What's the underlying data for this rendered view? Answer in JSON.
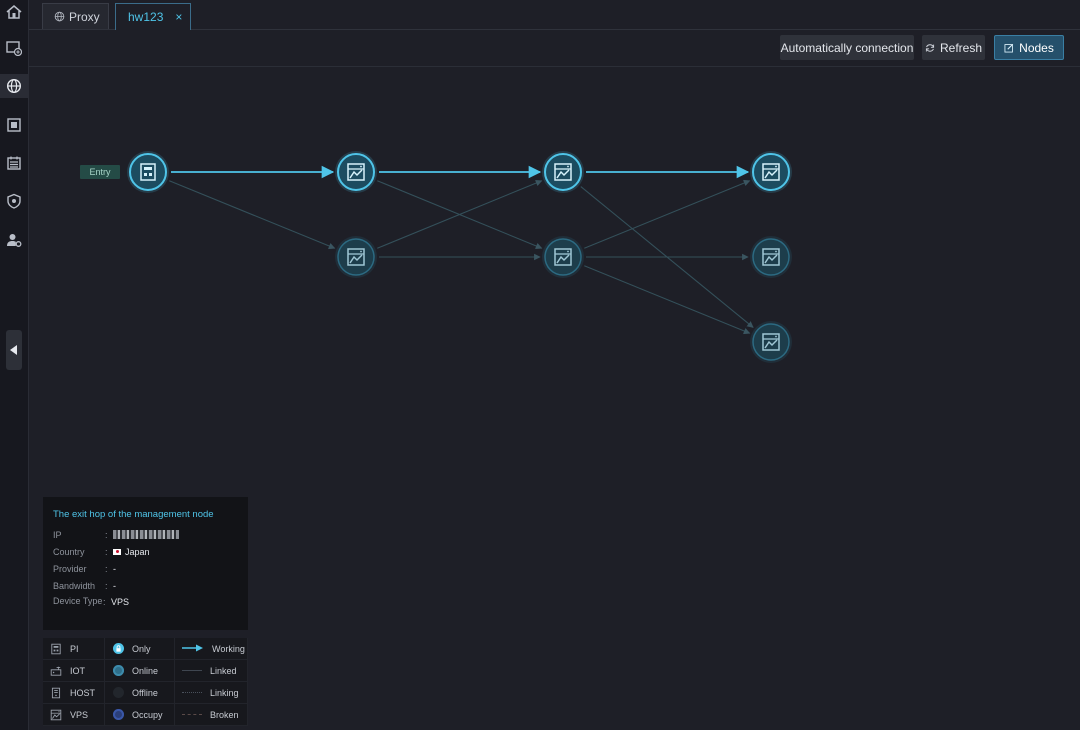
{
  "sidebar": {
    "items": [
      {
        "icon": "home-icon"
      },
      {
        "icon": "add-screen-icon"
      },
      {
        "icon": "globe-icon",
        "active": true
      },
      {
        "icon": "document-icon"
      },
      {
        "icon": "calendar-icon"
      },
      {
        "icon": "shield-icon"
      },
      {
        "icon": "user-settings-icon"
      }
    ],
    "collapse_icon": "triangle-left-icon"
  },
  "tabs": [
    {
      "label": "Proxy",
      "icon": "globe-icon",
      "active": false
    },
    {
      "label": "hw123",
      "close": "×",
      "active": true
    }
  ],
  "toolbar": {
    "auto_label": "Automatically connection",
    "refresh_label": "Refresh",
    "nodes_label": "Nodes"
  },
  "graph": {
    "entry_label": "Entry",
    "accent": "#4fc4e8",
    "nodes": [
      {
        "type": "PI",
        "status": "active"
      },
      {
        "type": "VPS",
        "status": "active"
      },
      {
        "type": "VPS",
        "status": "idle"
      },
      {
        "type": "VPS",
        "status": "active"
      },
      {
        "type": "VPS",
        "status": "idle"
      },
      {
        "type": "VPS",
        "status": "active"
      },
      {
        "type": "VPS",
        "status": "idle"
      },
      {
        "type": "VPS",
        "status": "idle"
      }
    ],
    "links": [
      {
        "from": 0,
        "to": 1,
        "kind": "Working"
      },
      {
        "from": 1,
        "to": 3,
        "kind": "Working"
      },
      {
        "from": 3,
        "to": 5,
        "kind": "Working"
      },
      {
        "from": 0,
        "to": 2,
        "kind": "Linked"
      },
      {
        "from": 1,
        "to": 4,
        "kind": "Linked"
      },
      {
        "from": 2,
        "to": 3,
        "kind": "Linked"
      },
      {
        "from": 2,
        "to": 4,
        "kind": "Linked"
      },
      {
        "from": 3,
        "to": 7,
        "kind": "Linked"
      },
      {
        "from": 4,
        "to": 5,
        "kind": "Linked"
      },
      {
        "from": 4,
        "to": 6,
        "kind": "Linked"
      },
      {
        "from": 4,
        "to": 7,
        "kind": "Linked"
      }
    ]
  },
  "info": {
    "title": "The exit hop of the management node",
    "ip_label": "IP",
    "country_label": "Country",
    "country_value": "Japan",
    "provider_label": "Provider",
    "provider_value": "-",
    "bandwidth_label": "Bandwidth",
    "bandwidth_value": "-",
    "device_type_label": "Device Type",
    "device_type_value": "VPS",
    "colon": ":"
  },
  "legend": {
    "types": [
      "PI",
      "IOT",
      "HOST",
      "VPS"
    ],
    "statuses": [
      "Only",
      "Online",
      "Offline",
      "Occupy"
    ],
    "links": [
      "Working",
      "Linked",
      "Linking",
      "Broken"
    ]
  }
}
